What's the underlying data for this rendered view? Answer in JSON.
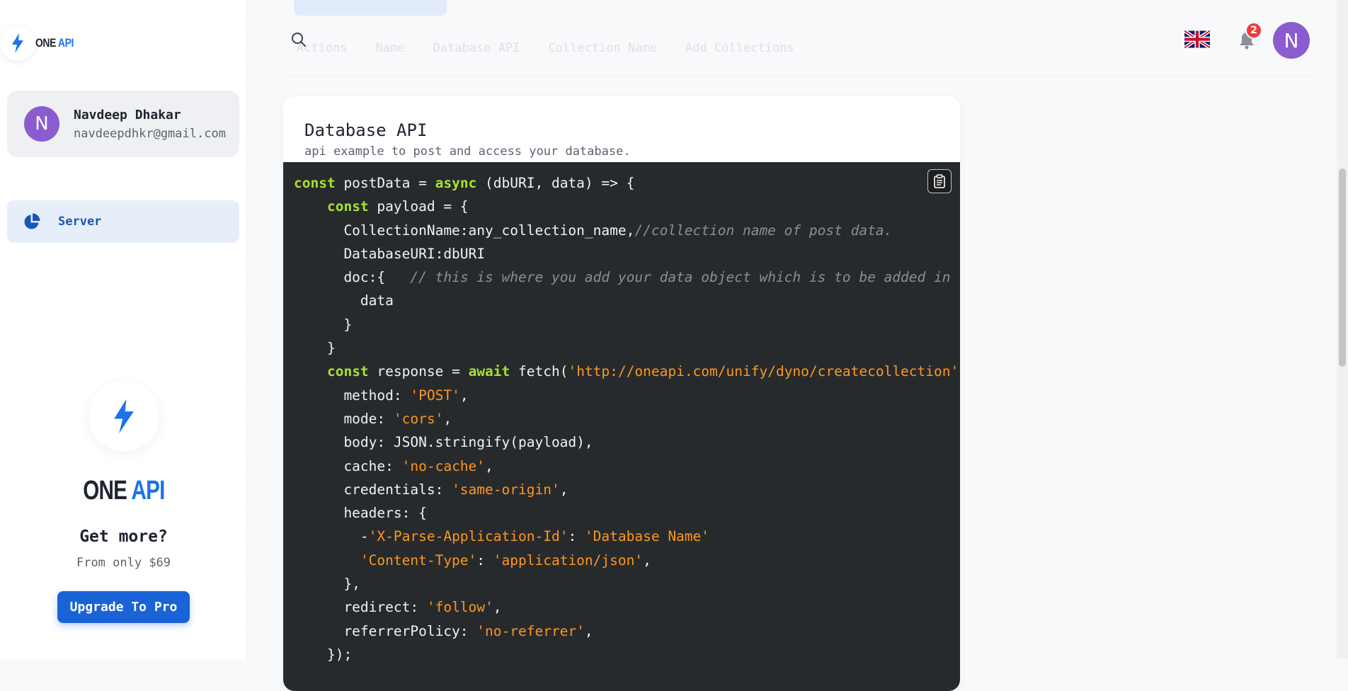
{
  "brand": {
    "one": "ONE",
    "api": "API"
  },
  "user": {
    "initial": "N",
    "name": "Navdeep Dhakar",
    "email": "navdeepdhkr@gmail.com"
  },
  "nav": {
    "items": [
      {
        "label": "Server",
        "icon": "pie-chart-icon",
        "active": true
      }
    ]
  },
  "promo": {
    "brand_one": "ONE",
    "brand_api": "API",
    "title": "Get more?",
    "subtitle": "From only $69",
    "button_label": "Upgrade To Pro"
  },
  "header": {
    "faded_tabs": [
      "Actions",
      "Name",
      "Database API",
      "Collection Name",
      "Add Collections"
    ],
    "notification_count": "2",
    "avatar_initial": "N",
    "language_flag": "uk-flag-icon"
  },
  "card": {
    "title": "Database API",
    "subtitle": "api example to post and access your database."
  },
  "code_lines": [
    [
      {
        "t": "kw",
        "v": "const"
      },
      {
        "t": "p",
        "v": " postData = "
      },
      {
        "t": "kw",
        "v": "async"
      },
      {
        "t": "p",
        "v": " (dbURI, data) => {"
      }
    ],
    [
      {
        "t": "p",
        "v": "    "
      },
      {
        "t": "kw",
        "v": "const"
      },
      {
        "t": "p",
        "v": " payload = {"
      }
    ],
    [
      {
        "t": "p",
        "v": "      CollectionName:any_collection_name,"
      },
      {
        "t": "cm",
        "v": "//collection name of post data."
      }
    ],
    [
      {
        "t": "p",
        "v": "      DatabaseURI:dbURI"
      }
    ],
    [
      {
        "t": "p",
        "v": "      doc:{   "
      },
      {
        "t": "cm",
        "v": "// this is where you add your data object which is to be added in the collection"
      }
    ],
    [
      {
        "t": "p",
        "v": "        data"
      }
    ],
    [
      {
        "t": "p",
        "v": "      }"
      }
    ],
    [
      {
        "t": "p",
        "v": "    }"
      }
    ],
    [
      {
        "t": "p",
        "v": "    "
      },
      {
        "t": "kw",
        "v": "const"
      },
      {
        "t": "p",
        "v": " response = "
      },
      {
        "t": "kw",
        "v": "await"
      },
      {
        "t": "p",
        "v": " fetch("
      },
      {
        "t": "str",
        "v": "'http://oneapi.com/unify/dyno/createcollection'"
      },
      {
        "t": "p",
        "v": ", {"
      }
    ],
    [
      {
        "t": "p",
        "v": "      method: "
      },
      {
        "t": "str",
        "v": "'POST'"
      },
      {
        "t": "p",
        "v": ","
      }
    ],
    [
      {
        "t": "p",
        "v": "      mode: "
      },
      {
        "t": "str",
        "v": "'cors'"
      },
      {
        "t": "p",
        "v": ","
      }
    ],
    [
      {
        "t": "p",
        "v": "      body: JSON.stringify(payload),"
      }
    ],
    [
      {
        "t": "p",
        "v": "      cache: "
      },
      {
        "t": "str",
        "v": "'no-cache'"
      },
      {
        "t": "p",
        "v": ","
      }
    ],
    [
      {
        "t": "p",
        "v": "      credentials: "
      },
      {
        "t": "str",
        "v": "'same-origin'"
      },
      {
        "t": "p",
        "v": ","
      }
    ],
    [
      {
        "t": "p",
        "v": "      headers: {"
      }
    ],
    [
      {
        "t": "p",
        "v": "        -"
      },
      {
        "t": "str",
        "v": "'X-Parse-Application-Id'"
      },
      {
        "t": "p",
        "v": ": "
      },
      {
        "t": "str",
        "v": "'Database Name'"
      }
    ],
    [
      {
        "t": "p",
        "v": "        "
      },
      {
        "t": "str",
        "v": "'Content-Type'"
      },
      {
        "t": "p",
        "v": ": "
      },
      {
        "t": "str",
        "v": "'application/json'"
      },
      {
        "t": "p",
        "v": ","
      }
    ],
    [
      {
        "t": "p",
        "v": "      },"
      }
    ],
    [
      {
        "t": "p",
        "v": "      redirect: "
      },
      {
        "t": "str",
        "v": "'follow'"
      },
      {
        "t": "p",
        "v": ","
      }
    ],
    [
      {
        "t": "p",
        "v": "      referrerPolicy: "
      },
      {
        "t": "str",
        "v": "'no-referrer'"
      },
      {
        "t": "p",
        "v": ","
      }
    ],
    [
      {
        "t": "p",
        "v": "    });"
      }
    ]
  ],
  "colors": {
    "accent": "#1a73e8",
    "button": "#1a63d6",
    "avatar": "#8a5cd0",
    "badge": "#ef3b3b",
    "code_bg": "#272a2d",
    "keyword": "#a6e22e",
    "string": "#fd971f",
    "comment": "#8a8f95"
  }
}
